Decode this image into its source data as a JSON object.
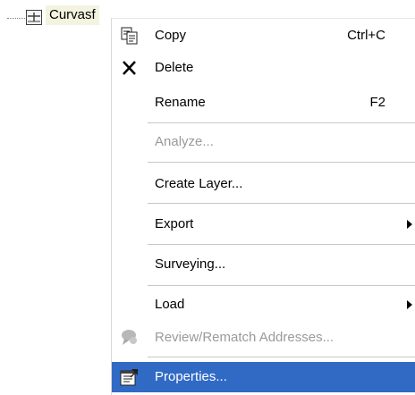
{
  "tree": {
    "node_label": "Curvasf",
    "icons": {
      "node": "layer-group-icon"
    }
  },
  "menu": {
    "items": [
      {
        "label": "Copy",
        "shortcut": "Ctrl+C",
        "icon": "copy-icon",
        "enabled": true
      },
      {
        "label": "Delete",
        "shortcut": "",
        "icon": "delete-x-icon",
        "enabled": true
      },
      {
        "label": "Rename",
        "shortcut": "F2",
        "icon": "",
        "enabled": true
      },
      {
        "label": "Analyze...",
        "shortcut": "",
        "icon": "",
        "enabled": false
      },
      {
        "label": "Create Layer...",
        "shortcut": "",
        "icon": "",
        "enabled": true
      },
      {
        "label": "Export",
        "shortcut": "",
        "icon": "",
        "enabled": true,
        "submenu": true
      },
      {
        "label": "Surveying...",
        "shortcut": "",
        "icon": "",
        "enabled": true
      },
      {
        "label": "Load",
        "shortcut": "",
        "icon": "",
        "enabled": true,
        "submenu": true
      },
      {
        "label": "Review/Rematch Addresses...",
        "shortcut": "",
        "icon": "review-addresses-icon",
        "enabled": false
      },
      {
        "label": "Properties...",
        "shortcut": "",
        "icon": "properties-icon",
        "enabled": true,
        "selected": true
      }
    ]
  },
  "colors": {
    "selection": "#316ac5",
    "disabled_text": "#9a9a9a",
    "tree_label_bg": "#f3f3e0"
  }
}
